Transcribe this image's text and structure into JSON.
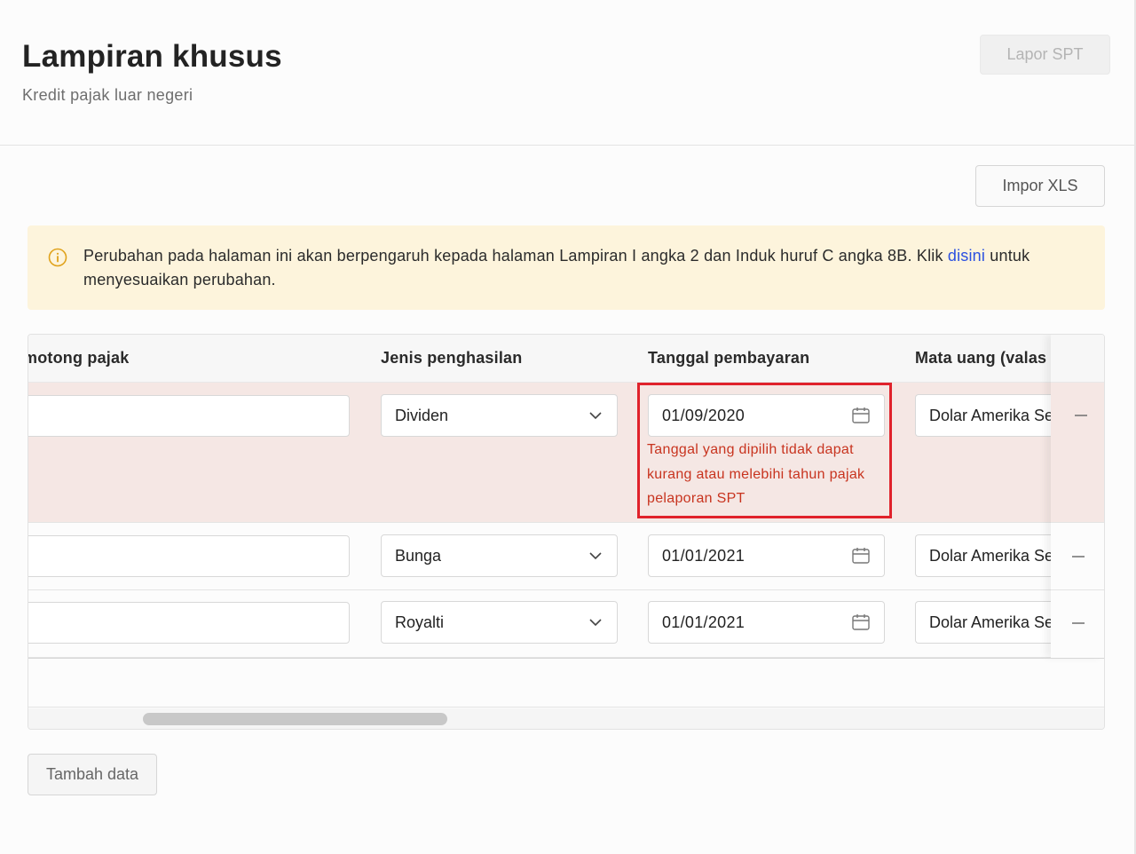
{
  "header": {
    "title": "Lampiran khusus",
    "subtitle": "Kredit pajak luar negeri",
    "lapor_label": "Lapor SPT"
  },
  "toolbar": {
    "impor_label": "Impor XLS"
  },
  "banner": {
    "icon": "info-icon",
    "text_before": "Perubahan pada halaman ini akan berpengaruh kepada halaman Lampiran I angka 2 dan Induk huruf C angka 8B. Klik ",
    "link": "disini",
    "text_after": " untuk menyesuaikan perubahan."
  },
  "table": {
    "columns": [
      "motong pajak",
      "Jenis penghasilan",
      "Tanggal pembayaran",
      "Mata uang (valas"
    ],
    "rows": [
      {
        "jenis": "Dividen",
        "tanggal": "01/09/2020",
        "mata_uang": "Dolar Amerika Serikat",
        "error": "Tanggal yang dipilih tidak dapat kurang atau melebihi tahun pajak pelaporan SPT"
      },
      {
        "jenis": "Bunga",
        "tanggal": "01/01/2021",
        "mata_uang": "Dolar Amerika Serikat"
      },
      {
        "jenis": "Royalti",
        "tanggal": "01/01/2021",
        "mata_uang": "Dolar Amerika Serikat"
      }
    ]
  },
  "actions": {
    "tambah_label": "Tambah data"
  },
  "colors": {
    "error": "#e0222b",
    "error_text": "#c8341f",
    "link": "#2b50e0",
    "banner_bg": "#fdf4dc",
    "error_row_bg": "#f5e7e4"
  }
}
